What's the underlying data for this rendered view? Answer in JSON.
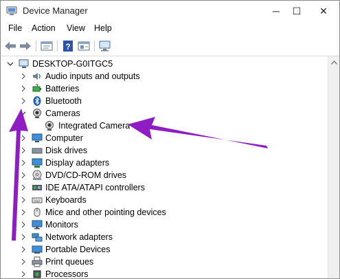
{
  "window": {
    "title": "Device Manager",
    "controls": {
      "minimize": "─",
      "maximize": "☐",
      "close": "✕"
    }
  },
  "menu": [
    "File",
    "Action",
    "View",
    "Help"
  ],
  "toolbar": [
    "back-icon",
    "forward-icon",
    "properties-sheet-icon",
    "help-icon",
    "show-hidden-icon",
    "monitor-scan-icon"
  ],
  "tree": {
    "root": "DESKTOP-G0ITGC5",
    "items": [
      {
        "label": "Audio inputs and outputs",
        "icon": "speaker-icon",
        "state": "collapsed"
      },
      {
        "label": "Batteries",
        "icon": "battery-icon",
        "state": "collapsed"
      },
      {
        "label": "Bluetooth",
        "icon": "bluetooth-icon",
        "state": "collapsed"
      },
      {
        "label": "Cameras",
        "icon": "camera-icon",
        "state": "expanded",
        "children": [
          {
            "label": "Integrated Camera",
            "icon": "webcam-icon"
          }
        ]
      },
      {
        "label": "Computer",
        "icon": "computer-icon",
        "state": "collapsed"
      },
      {
        "label": "Disk drives",
        "icon": "disk-drive-icon",
        "state": "collapsed"
      },
      {
        "label": "Display adapters",
        "icon": "display-adapter-icon",
        "state": "collapsed"
      },
      {
        "label": "DVD/CD-ROM drives",
        "icon": "dvd-icon",
        "state": "collapsed"
      },
      {
        "label": "IDE ATA/ATAPI controllers",
        "icon": "ide-controller-icon",
        "state": "collapsed"
      },
      {
        "label": "Keyboards",
        "icon": "keyboard-icon",
        "state": "collapsed"
      },
      {
        "label": "Mice and other pointing devices",
        "icon": "mouse-icon",
        "state": "collapsed"
      },
      {
        "label": "Monitors",
        "icon": "monitor-icon",
        "state": "collapsed"
      },
      {
        "label": "Network adapters",
        "icon": "network-icon",
        "state": "collapsed"
      },
      {
        "label": "Portable Devices",
        "icon": "portable-device-icon",
        "state": "collapsed"
      },
      {
        "label": "Print queues",
        "icon": "printer-icon",
        "state": "collapsed"
      },
      {
        "label": "Processors",
        "icon": "processor-icon",
        "state": "collapsed"
      }
    ]
  },
  "annotation": {
    "arrow_color": "#8e1ec4"
  },
  "colors": {
    "accent_blue": "#1e5fb4",
    "frame": "#8a8a8a"
  }
}
